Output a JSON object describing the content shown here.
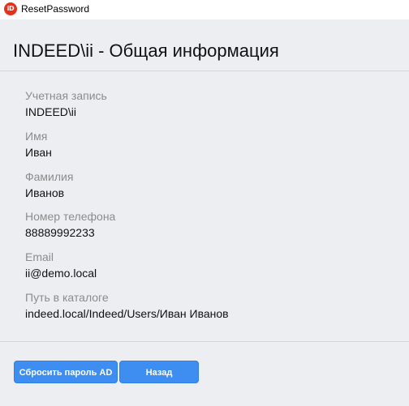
{
  "window": {
    "title": "ResetPassword",
    "icon_text": "iD",
    "icon_color": "#e3321e"
  },
  "page": {
    "title": "INDEED\\ii - Общая информация"
  },
  "fields": [
    {
      "label": "Учетная запись",
      "value": "INDEED\\ii"
    },
    {
      "label": "Имя",
      "value": "Иван"
    },
    {
      "label": "Фамилия",
      "value": "Иванов"
    },
    {
      "label": "Номер телефона",
      "value": "88889992233"
    },
    {
      "label": "Email",
      "value": "ii@demo.local"
    },
    {
      "label": "Путь в каталоге",
      "value": "indeed.local/Indeed/Users/Иван Иванов"
    }
  ],
  "buttons": {
    "reset_label": "Сбросить пароль AD",
    "back_label": "Назад"
  },
  "colors": {
    "accent": "#3d8ef0",
    "background": "#eceef1",
    "label_text": "#8c8c8c"
  }
}
